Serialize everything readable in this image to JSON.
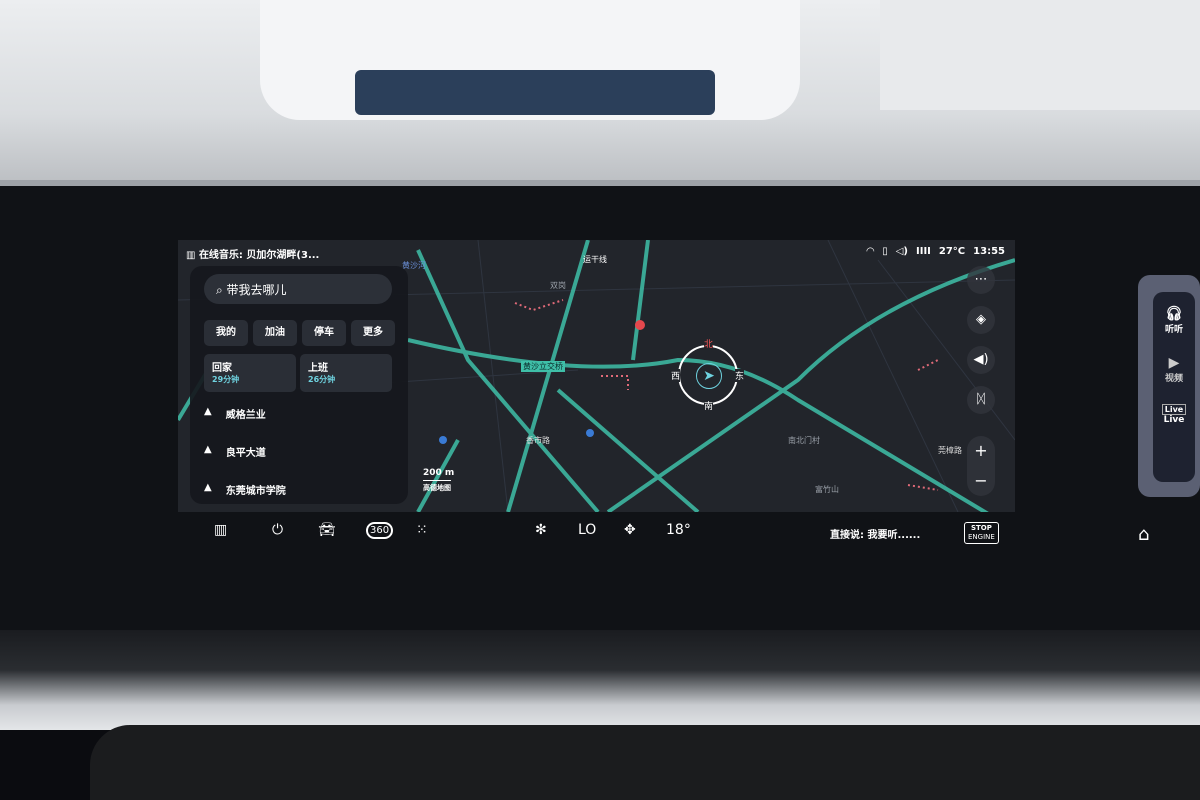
{
  "status": {
    "music": "在线音乐: 贝加尔湖畔(3...",
    "temperature": "27°C",
    "time": "13:55"
  },
  "search": {
    "placeholder": "带我去哪儿"
  },
  "quick": [
    "我的",
    "加油",
    "停车",
    "更多"
  ],
  "favorites": [
    {
      "label": "回家",
      "eta": "29分钟"
    },
    {
      "label": "上班",
      "eta": "26分钟"
    }
  ],
  "recent": [
    "威格兰业",
    "良平大道",
    "东莞城市学院"
  ],
  "map": {
    "labels": [
      "黄沙河",
      "运干线",
      "双岗",
      "黄沙立交桥",
      "香市路",
      "莞樟路",
      "南北门村",
      "富竹山"
    ],
    "compass": {
      "n": "北",
      "s": "南",
      "e": "东",
      "w": "西"
    },
    "scale": "200 m",
    "provider": "高德地图",
    "accent": "#3fbfa8"
  },
  "map_controls": [
    "more",
    "layers",
    "volume",
    "people",
    "zoom-in",
    "zoom-out"
  ],
  "bottom": {
    "ac_mode": "LO",
    "temp": "18°",
    "voice_hint": "直接说: 我要听......",
    "stop_top": "STOP",
    "stop_bottom": "ENGINE",
    "cam": "360"
  },
  "dock": [
    {
      "label": "听听"
    },
    {
      "label": "视频"
    },
    {
      "label": "Live"
    }
  ]
}
